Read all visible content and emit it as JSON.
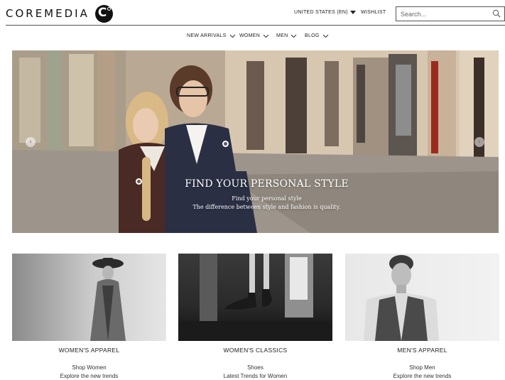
{
  "brand": {
    "logo_text": "COREMEDIA",
    "logo_mark": "C"
  },
  "header": {
    "locale": "UNITED STATES (EN)",
    "wishlist": "WISHLIST",
    "search_placeholder": "Search..."
  },
  "nav": [
    {
      "label": "NEW ARRIVALS"
    },
    {
      "label": "WOMEN"
    },
    {
      "label": "MEN"
    },
    {
      "label": "BLOG"
    }
  ],
  "hero": {
    "title": "FIND YOUR PERSONAL STYLE",
    "subtitle": "Find your personal style",
    "text": "The difference between style and fashion is quality."
  },
  "teasers": [
    {
      "title": "WOMEN'S APPAREL",
      "link1": "Shop Women",
      "link2": "Explore the new trends"
    },
    {
      "title": "WOMEN'S CLASSICS",
      "link1": "Shoes",
      "link2": "Latest Trends for Women"
    },
    {
      "title": "MEN'S APPAREL",
      "link1": "Shop Men",
      "link2": "Explore the new trends"
    }
  ],
  "icons": {
    "search": "search-icon",
    "locale_dropdown": "caret-down-icon",
    "nav_dropdown": "chevron-down-icon",
    "carousel_prev": "chevron-left-icon",
    "carousel_next": "chevron-right-icon",
    "hotspot": "hotspot-icon"
  }
}
